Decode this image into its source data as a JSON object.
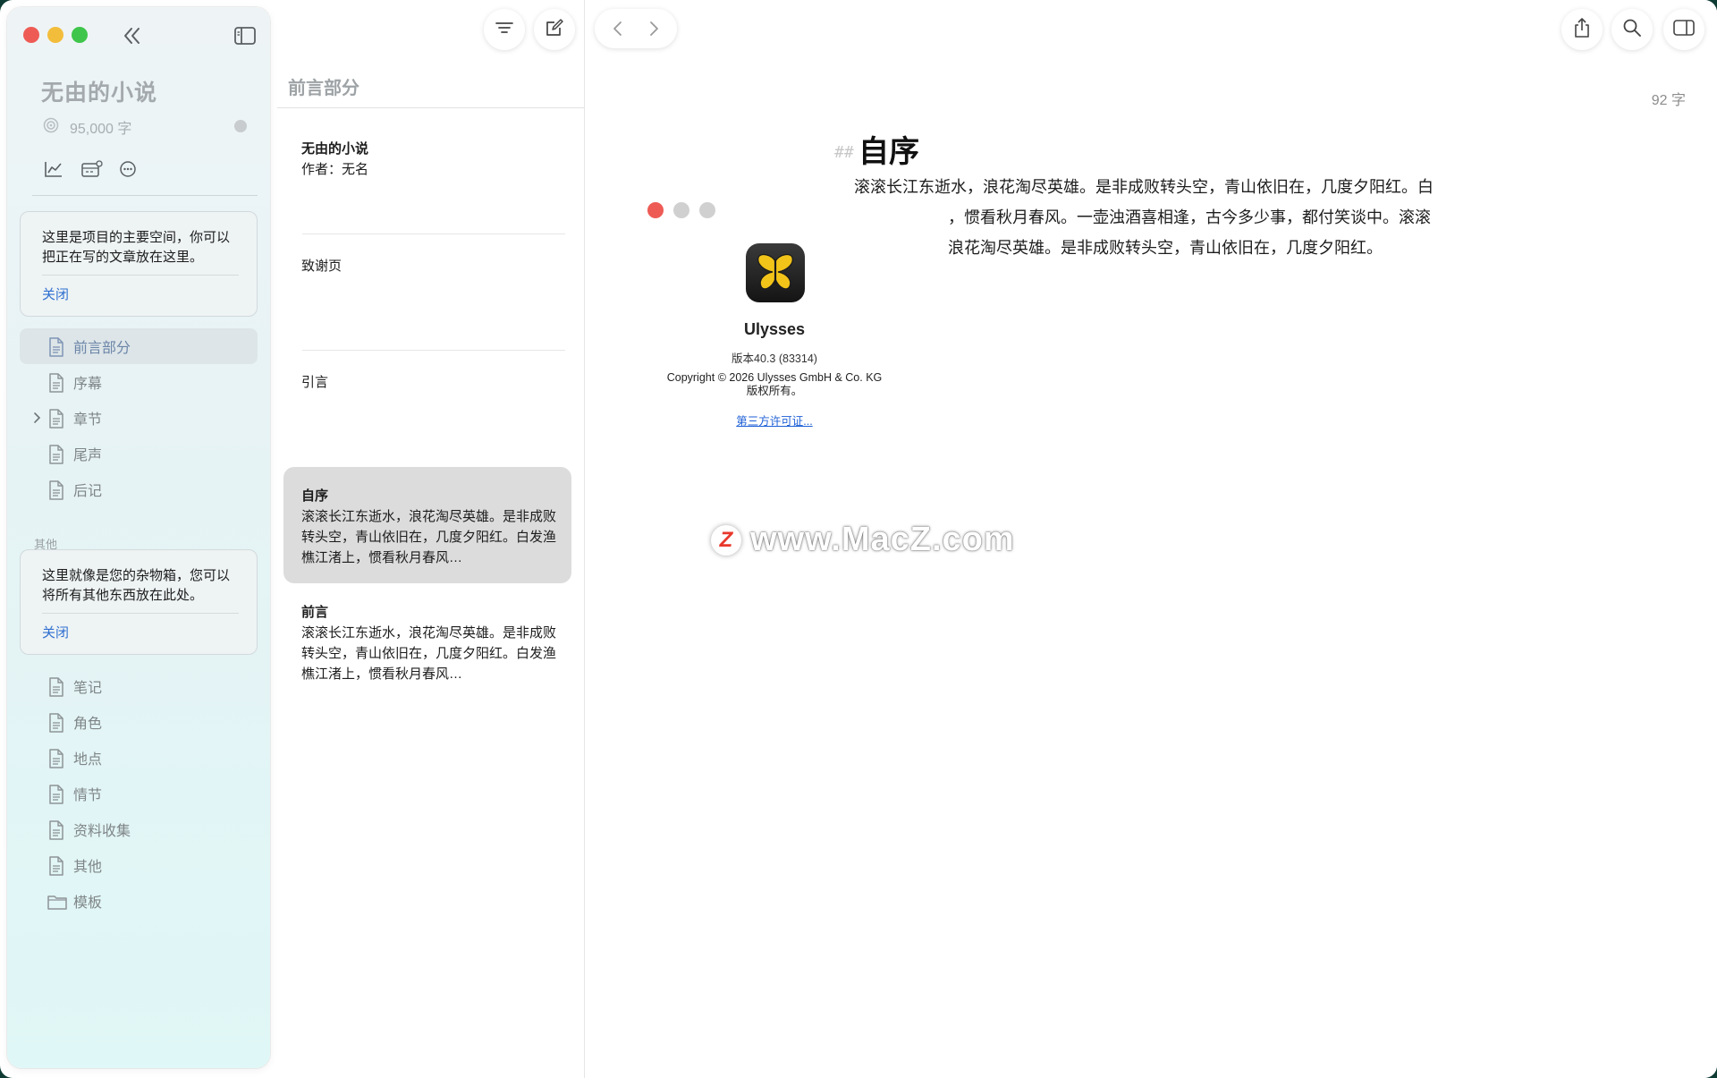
{
  "sidebar": {
    "project_title": "无由的小说",
    "word_goal": "95,000 字",
    "tip_main": "这里是项目的主要空间，你可以把正在写的文章放在这里。",
    "tip_main_close": "关闭",
    "items_main": [
      {
        "label": "前言部分",
        "selected": true
      },
      {
        "label": "序幕"
      },
      {
        "label": "章节",
        "expandable": true
      },
      {
        "label": "尾声"
      },
      {
        "label": "后记"
      }
    ],
    "section_other": "其他",
    "tip_other": "这里就像是您的杂物箱，您可以将所有其他东西放在此处。",
    "tip_other_close": "关闭",
    "items_other": [
      {
        "label": "笔记"
      },
      {
        "label": "角色"
      },
      {
        "label": "地点"
      },
      {
        "label": "情节"
      },
      {
        "label": "资料收集"
      },
      {
        "label": "其他"
      },
      {
        "label": "模板",
        "icon": "folder-icon"
      }
    ]
  },
  "sheet_list": {
    "title": "前言部分",
    "sheets": [
      {
        "title": "无由的小说",
        "body": "作者：无名"
      },
      {
        "title": "",
        "body": "致谢页"
      },
      {
        "title": "",
        "body": "引言"
      },
      {
        "title": "自序",
        "body": "滚滚长江东逝水，浪花淘尽英雄。是非成败转头空，青山依旧在，几度夕阳红。白发渔樵江渚上，惯看秋月春风…"
      },
      {
        "title": "前言",
        "body": "滚滚长江东逝水，浪花淘尽英雄。是非成败转头空，青山依旧在，几度夕阳红。白发渔樵江渚上，惯看秋月春风…"
      }
    ]
  },
  "editor": {
    "word_count": "92 字",
    "heading_markup": "##",
    "heading": "自序",
    "paragraph_lines": [
      "滚滚长江东逝水，浪花淘尽英雄。是非成败转头空，青山依旧在，几度夕阳红。白",
      "，惯看秋月春风。一壶浊酒喜相逢，古今多少事，都付笑谈中。滚滚",
      "浪花淘尽英雄。是非成败转头空，青山依旧在，几度夕阳红。"
    ]
  },
  "about": {
    "app_name": "Ulysses",
    "version": "版本40.3 (83314)",
    "copyright": "Copyright © 2026 Ulysses GmbH & Co. KG",
    "rights": "版权所有。",
    "license_link": "第三方许可证..."
  },
  "watermark": "www.MacZ.com",
  "watermark_logo": "Z",
  "colors": {
    "accent": "#2f6fd0",
    "traffic_red": "#ee5b55",
    "traffic_yellow": "#f3bd3c",
    "traffic_green": "#3fc54b",
    "selected_item": "#dde5e8",
    "selected_sheet": "#dcdcdc"
  }
}
